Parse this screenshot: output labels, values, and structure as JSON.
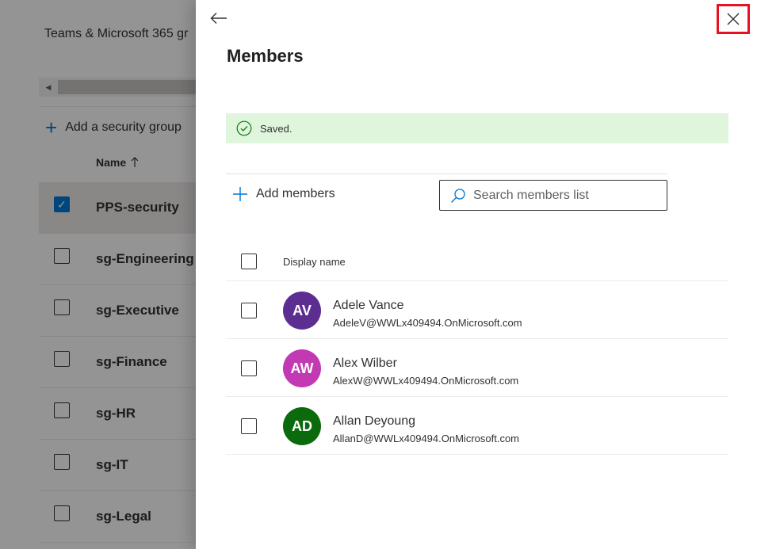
{
  "background": {
    "title": "Teams & Microsoft 365 gr",
    "add_group_label": "Add a security group",
    "column_name": "Name",
    "sort_icon": "arrow-up-icon",
    "groups": [
      {
        "name": "PPS-security",
        "checked": true
      },
      {
        "name": "sg-Engineering",
        "checked": false
      },
      {
        "name": "sg-Executive",
        "checked": false
      },
      {
        "name": "sg-Finance",
        "checked": false
      },
      {
        "name": "sg-HR",
        "checked": false
      },
      {
        "name": "sg-IT",
        "checked": false
      },
      {
        "name": "sg-Legal",
        "checked": false
      }
    ]
  },
  "panel": {
    "title": "Members",
    "back_icon": "arrow-left-icon",
    "close_icon": "close-icon",
    "saved_message": "Saved.",
    "add_members_label": "Add members",
    "search": {
      "placeholder": "Search members list",
      "value": ""
    },
    "column_display_name": "Display name",
    "members": [
      {
        "initials": "AV",
        "name": "Adele Vance",
        "email": "AdeleV@WWLx409494.OnMicrosoft.com",
        "color": "#5c2e91"
      },
      {
        "initials": "AW",
        "name": "Alex Wilber",
        "email": "AlexW@WWLx409494.OnMicrosoft.com",
        "color": "#c239b3"
      },
      {
        "initials": "AD",
        "name": "Allan Deyoung",
        "email": "AllanD@WWLx409494.OnMicrosoft.com",
        "color": "#0b6a0b"
      }
    ]
  },
  "colors": {
    "accent": "#0078d4",
    "success_bg": "#dff6dd",
    "success_icon": "#107c10",
    "highlight": "#e81123"
  }
}
